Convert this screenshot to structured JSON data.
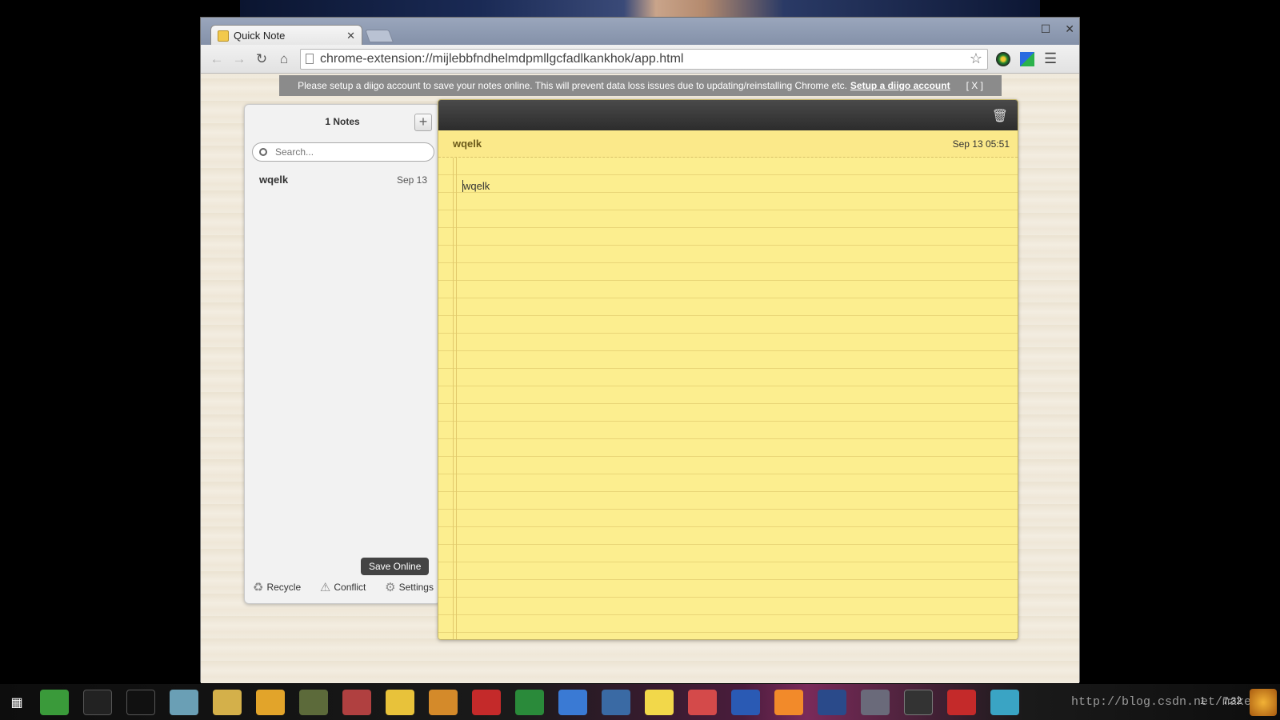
{
  "browser": {
    "tab_title": "Quick Note",
    "url": "chrome-extension://mijlebbfndhelmdpmllgcfadlkankhok/app.html"
  },
  "notice": {
    "text": "Please setup a diigo account to save your notes online. This will prevent data loss issues due to updating/reinstalling Chrome etc.",
    "link": "Setup a diigo account",
    "close": "[ X ]"
  },
  "sidebar": {
    "count": "1 Notes",
    "search_placeholder": "Search...",
    "notes": [
      {
        "title": "wqelk",
        "date": "Sep 13"
      }
    ],
    "footer": {
      "recycle": "Recycle",
      "conflict": "Conflict",
      "settings": "Settings"
    },
    "tooltip": "Save Online"
  },
  "editor": {
    "title": "wqelk",
    "date": "Sep 13 05:51",
    "body": "wqelk"
  },
  "taskbar": {
    "clock": "7:32",
    "badge": "1",
    "watermark": "http://blog.csdn.net/makeli"
  },
  "colors": {
    "note_yellow": "#fcee8f",
    "editor_header": "#2c2c2c",
    "notice_bg": "#8b8b8b"
  }
}
